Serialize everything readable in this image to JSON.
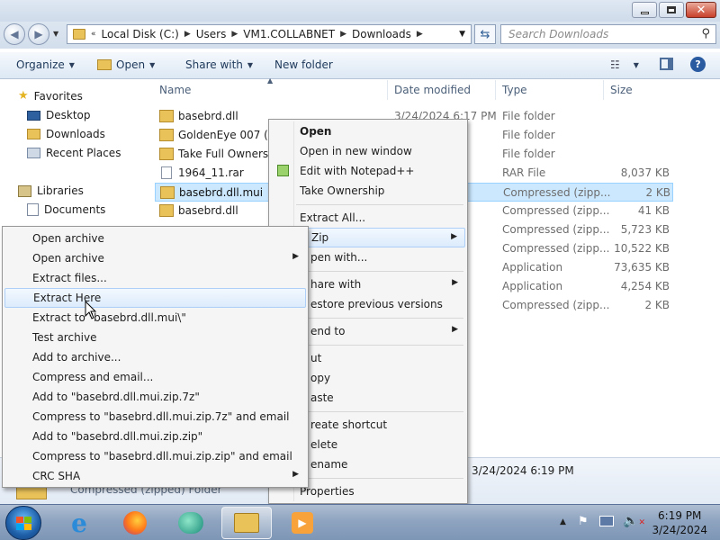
{
  "address": {
    "segments": [
      "Local Disk (C:)",
      "Users",
      "VM1.COLLABNET",
      "Downloads"
    ],
    "search_placeholder": "Search Downloads"
  },
  "toolbar": {
    "organize": "Organize",
    "open": "Open",
    "share_with": "Share with",
    "new_folder": "New folder"
  },
  "nav": {
    "favorites": "Favorites",
    "desktop": "Desktop",
    "downloads": "Downloads",
    "recent_places": "Recent Places",
    "libraries": "Libraries",
    "documents": "Documents"
  },
  "columns": {
    "name": "Name",
    "date_modified": "Date modified",
    "type": "Type",
    "size": "Size"
  },
  "files": [
    {
      "name": "basebrd.dll",
      "date": "3/24/2024 6:17 PM",
      "type": "File folder",
      "size": "",
      "icon": "folder-icon"
    },
    {
      "name": "GoldenEye 007 (USA)",
      "date": "",
      "type": "File folder",
      "size": "",
      "icon": "folder-icon"
    },
    {
      "name": "Take Full Ownership",
      "date": "",
      "type": "File folder",
      "size": "",
      "icon": "folder-icon"
    },
    {
      "name": "1964_11.rar",
      "date": "",
      "type": "RAR File",
      "size": "8,037 KB",
      "icon": "file-icon"
    },
    {
      "name": "basebrd.dll.mui",
      "date": "",
      "type": "Compressed (zipp...",
      "size": "2 KB",
      "icon": "zip-folder-icon"
    },
    {
      "name": "basebrd.dll",
      "date": "",
      "type": "Compressed (zipp...",
      "size": "41 KB",
      "icon": "zip-folder-icon"
    },
    {
      "name": "",
      "date": "",
      "type": "Compressed (zipp...",
      "size": "5,723 KB",
      "icon": ""
    },
    {
      "name": "",
      "date": "",
      "type": "Compressed (zipp...",
      "size": "10,522 KB",
      "icon": ""
    },
    {
      "name": "",
      "date": "",
      "type": "Application",
      "size": "73,635 KB",
      "icon": ""
    },
    {
      "name": "",
      "date": "",
      "type": "Application",
      "size": "4,254 KB",
      "icon": ""
    },
    {
      "name": "",
      "date": "",
      "type": "Compressed (zipp...",
      "size": "2 KB",
      "icon": ""
    }
  ],
  "details": {
    "date": "3/24/2024 6:19 PM",
    "type": "Compressed (zipped) Folder"
  },
  "explorer_menu": {
    "open": "Open",
    "open_new_window": "Open in new window",
    "edit_notepad": "Edit with Notepad++",
    "take_ownership": "Take Ownership",
    "extract_all": "Extract All...",
    "zip": "Zip",
    "open_with": "pen with...",
    "share_with": "hare with",
    "restore": "estore previous versions",
    "send_to": "end to",
    "cut": "ut",
    "copy": "opy",
    "paste": "aste",
    "create_shortcut": "reate shortcut",
    "delete": "elete",
    "rename": "ename",
    "properties": "Properties"
  },
  "sevenzip_menu": {
    "open_archive": "Open archive",
    "open_archive_sub": "Open archive",
    "extract_files": "Extract files...",
    "extract_here": "Extract Here",
    "extract_to": "Extract to \"basebrd.dll.mui\\\"",
    "test_archive": "Test archive",
    "add_to_archive": "Add to archive...",
    "compress_email": "Compress and email...",
    "add_7z": "Add to \"basebrd.dll.mui.zip.7z\"",
    "compress_7z_email": "Compress to \"basebrd.dll.mui.zip.7z\" and email",
    "add_zip": "Add to \"basebrd.dll.mui.zip.zip\"",
    "compress_zip_email": "Compress to \"basebrd.dll.mui.zip.zip\" and email",
    "crc_sha": "CRC SHA"
  },
  "clock": {
    "time": "6:19 PM",
    "date": "3/24/2024"
  }
}
